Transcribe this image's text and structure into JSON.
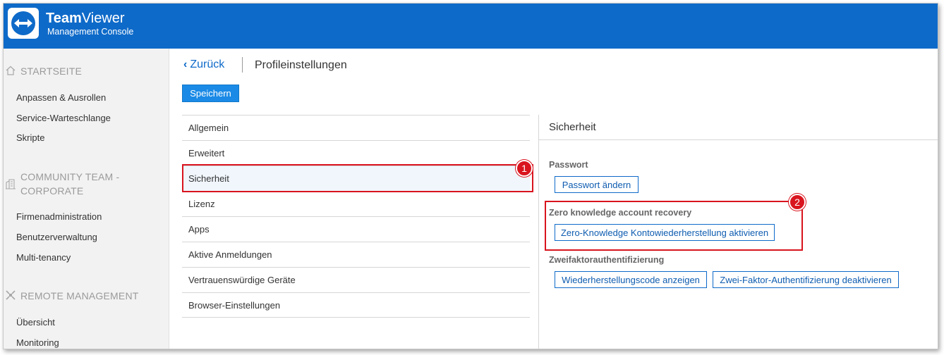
{
  "header": {
    "brand_bold": "Team",
    "brand_light": "Viewer",
    "subtitle": "Management Console"
  },
  "sidebar": {
    "sections": [
      {
        "title": "STARTSEITE",
        "icon": "home-icon",
        "items": [
          "Anpassen & Ausrollen",
          "Service-Warteschlange",
          "Skripte"
        ]
      },
      {
        "title_line1": "COMMUNITY TEAM -",
        "title_line2": "CORPORATE",
        "icon": "building-icon",
        "items": [
          "Firmenadministration",
          "Benutzerverwaltung",
          "Multi-tenancy"
        ]
      },
      {
        "title": "REMOTE MANAGEMENT",
        "icon": "remote-management-icon",
        "items": [
          "Übersicht",
          "Monitoring"
        ]
      }
    ]
  },
  "topbar": {
    "back_label": "Zurück",
    "page_title": "Profileinstellungen",
    "save_label": "Speichern"
  },
  "settings_menu": {
    "items": [
      "Allgemein",
      "Erweitert",
      "Sicherheit",
      "Lizenz",
      "Apps",
      "Aktive Anmeldungen",
      "Vertrauenswürdige Geräte",
      "Browser-Einstellungen"
    ],
    "selected": "Sicherheit"
  },
  "security": {
    "title": "Sicherheit",
    "password_label": "Passwort",
    "change_password_button": "Passwort ändern",
    "zk_label": "Zero knowledge account recovery",
    "zk_button": "Zero-Knowledge Kontowiederherstellung aktivieren",
    "tfa_label": "Zweifaktorauthentifizierung",
    "show_recovery_button": "Wiederherstellungscode anzeigen",
    "disable_tfa_button": "Zwei-Faktor-Authentifizierung deaktivieren"
  },
  "callouts": {
    "one": "1",
    "two": "2"
  },
  "colors": {
    "header": "#0e6ac9",
    "accent": "#1a8ae6",
    "callout": "#d9141e"
  }
}
